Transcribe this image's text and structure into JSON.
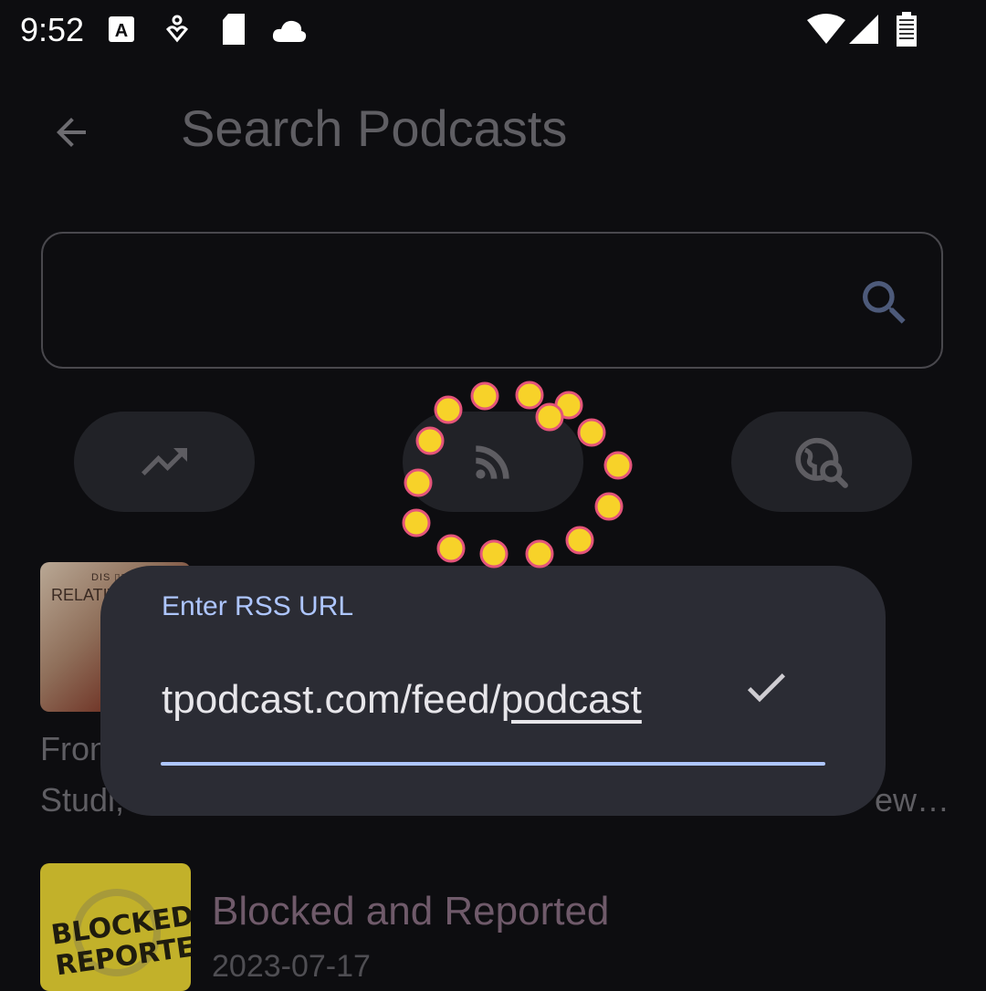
{
  "status_bar": {
    "time": "9:52",
    "icons": [
      "keyboard-a-icon",
      "hearing-icon",
      "sd-card-icon",
      "cloud-icon",
      "wifi-icon",
      "signal-icon",
      "battery-icon"
    ]
  },
  "app_bar": {
    "back_icon": "arrow-back-icon",
    "title": "Search Podcasts"
  },
  "search": {
    "value": "",
    "icon": "search-icon"
  },
  "chips": [
    {
      "name": "trending",
      "icon": "trending-up-icon"
    },
    {
      "name": "rss",
      "icon": "rss-feed-icon"
    },
    {
      "name": "web-search",
      "icon": "travel-explore-icon"
    }
  ],
  "results": [
    {
      "thumb_caption_small": "DIS ▯▯▯ ▯ ▯ NA",
      "thumb_caption": "RELATIVE",
      "text_line1": "Fron",
      "text_line2": "Studi,",
      "text_tail": "ew…"
    },
    {
      "thumb_caption": "BLOCKED&\nREPORTED",
      "title": "Blocked and Reported",
      "date": "2023-07-17"
    }
  ],
  "dialog": {
    "label": "Enter RSS URL",
    "value_prefix": "tpodcast.com/feed/",
    "value_composing": "podcast",
    "confirm_icon": "check-icon"
  },
  "colors": {
    "background": "#0d0d10",
    "dialog": "#2b2c34",
    "accent": "#aec6ff",
    "chip": "#212227",
    "tap_indicator": "#f5d02a"
  }
}
